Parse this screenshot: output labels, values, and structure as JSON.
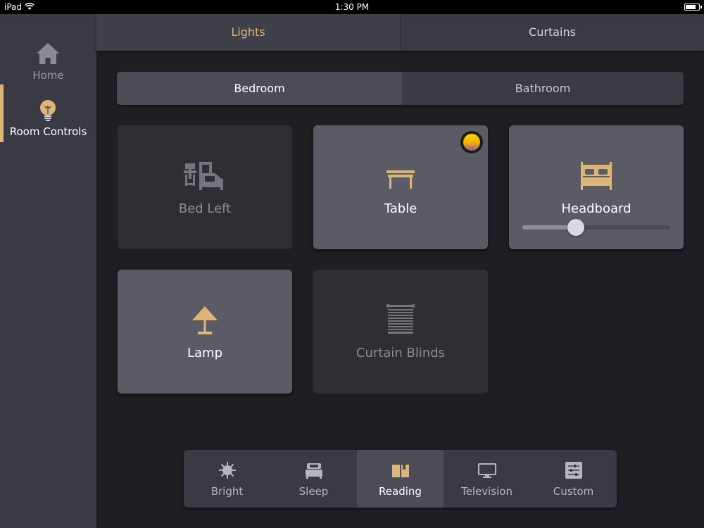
{
  "status_bar": {
    "carrier": "iPad",
    "time": "1:30 PM"
  },
  "sidebar": {
    "items": [
      {
        "label": "Home",
        "icon": "home-icon"
      },
      {
        "label": "Room Controls",
        "icon": "lightbulb-icon",
        "active": true
      }
    ]
  },
  "top_tabs": [
    {
      "label": "Lights",
      "active": true
    },
    {
      "label": "Curtains",
      "active": false
    }
  ],
  "rooms": [
    {
      "label": "Bedroom",
      "active": true
    },
    {
      "label": "Bathroom",
      "active": false
    }
  ],
  "devices": [
    {
      "label": "Bed Left",
      "icon": "bedroom-furniture-icon",
      "state": "off"
    },
    {
      "label": "Table",
      "icon": "table-icon",
      "state": "on",
      "badge_color": "#ffd200"
    },
    {
      "label": "Headboard",
      "icon": "bed-icon",
      "state": "on",
      "level": 0.36
    },
    {
      "label": "Lamp",
      "icon": "lamp-icon",
      "state": "on"
    },
    {
      "label": "Curtain Blinds",
      "icon": "blinds-icon",
      "state": "off"
    }
  ],
  "scenes": [
    {
      "label": "Bright",
      "icon": "sun-icon"
    },
    {
      "label": "Sleep",
      "icon": "sleep-bed-icon"
    },
    {
      "label": "Reading",
      "icon": "book-icon",
      "active": true
    },
    {
      "label": "Television",
      "icon": "tv-icon"
    },
    {
      "label": "Custom",
      "icon": "sliders-icon"
    }
  ],
  "colors": {
    "accent": "#dcb679",
    "background": "#1e1e23",
    "panel": "#3a3a44",
    "tile_on": "#5b5b66",
    "tile_off": "#2e2e34"
  }
}
